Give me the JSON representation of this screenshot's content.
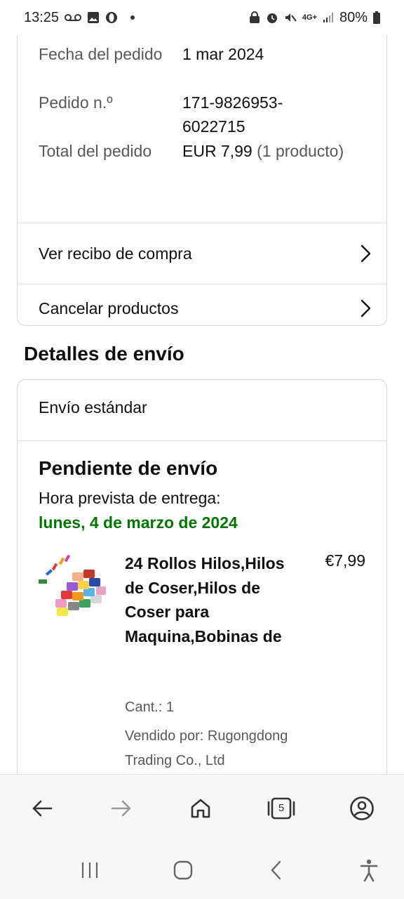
{
  "status_bar": {
    "time": "13:25",
    "battery": "80%",
    "network": "4G+"
  },
  "order_summary": {
    "order_date_label": "Fecha del pedido",
    "order_date_value": "1 mar 2024",
    "order_number_label": "Pedido n.º",
    "order_number_value": "171-9826953-6022715",
    "order_total_label": "Total del pedido",
    "order_total_value": "EUR 7,99",
    "order_total_count": "(1 producto)",
    "links": [
      {
        "label": "Ver recibo de compra"
      },
      {
        "label": "Cancelar productos"
      }
    ]
  },
  "shipping": {
    "section_title": "Detalles de envío",
    "method": "Envío estándar",
    "status_title": "Pendiente de envío",
    "eta_label": "Hora prevista de entrega:",
    "eta_date": "lunes, 4 de marzo de 2024",
    "product": {
      "title": "24 Rollos Hilos,Hilos de Coser,Hilos de Coser para Maquina,Bobinas de",
      "price": "€7,99",
      "quantity": "Cant.: 1",
      "seller": "Vendido por: Rugongdong Trading Co., Ltd"
    }
  },
  "browser_bar": {
    "tab_count": "5",
    "icons": [
      "back-arrow-icon",
      "forward-arrow-icon",
      "home-icon",
      "tabs-icon",
      "account-icon"
    ]
  },
  "system_nav": {
    "icons": [
      "recents-icon",
      "home-circle-icon",
      "back-icon",
      "accessibility-icon"
    ]
  },
  "colors": {
    "eta_green": "#007600",
    "border": "#d5d9d9",
    "text": "#0f1111",
    "muted": "#565959"
  }
}
